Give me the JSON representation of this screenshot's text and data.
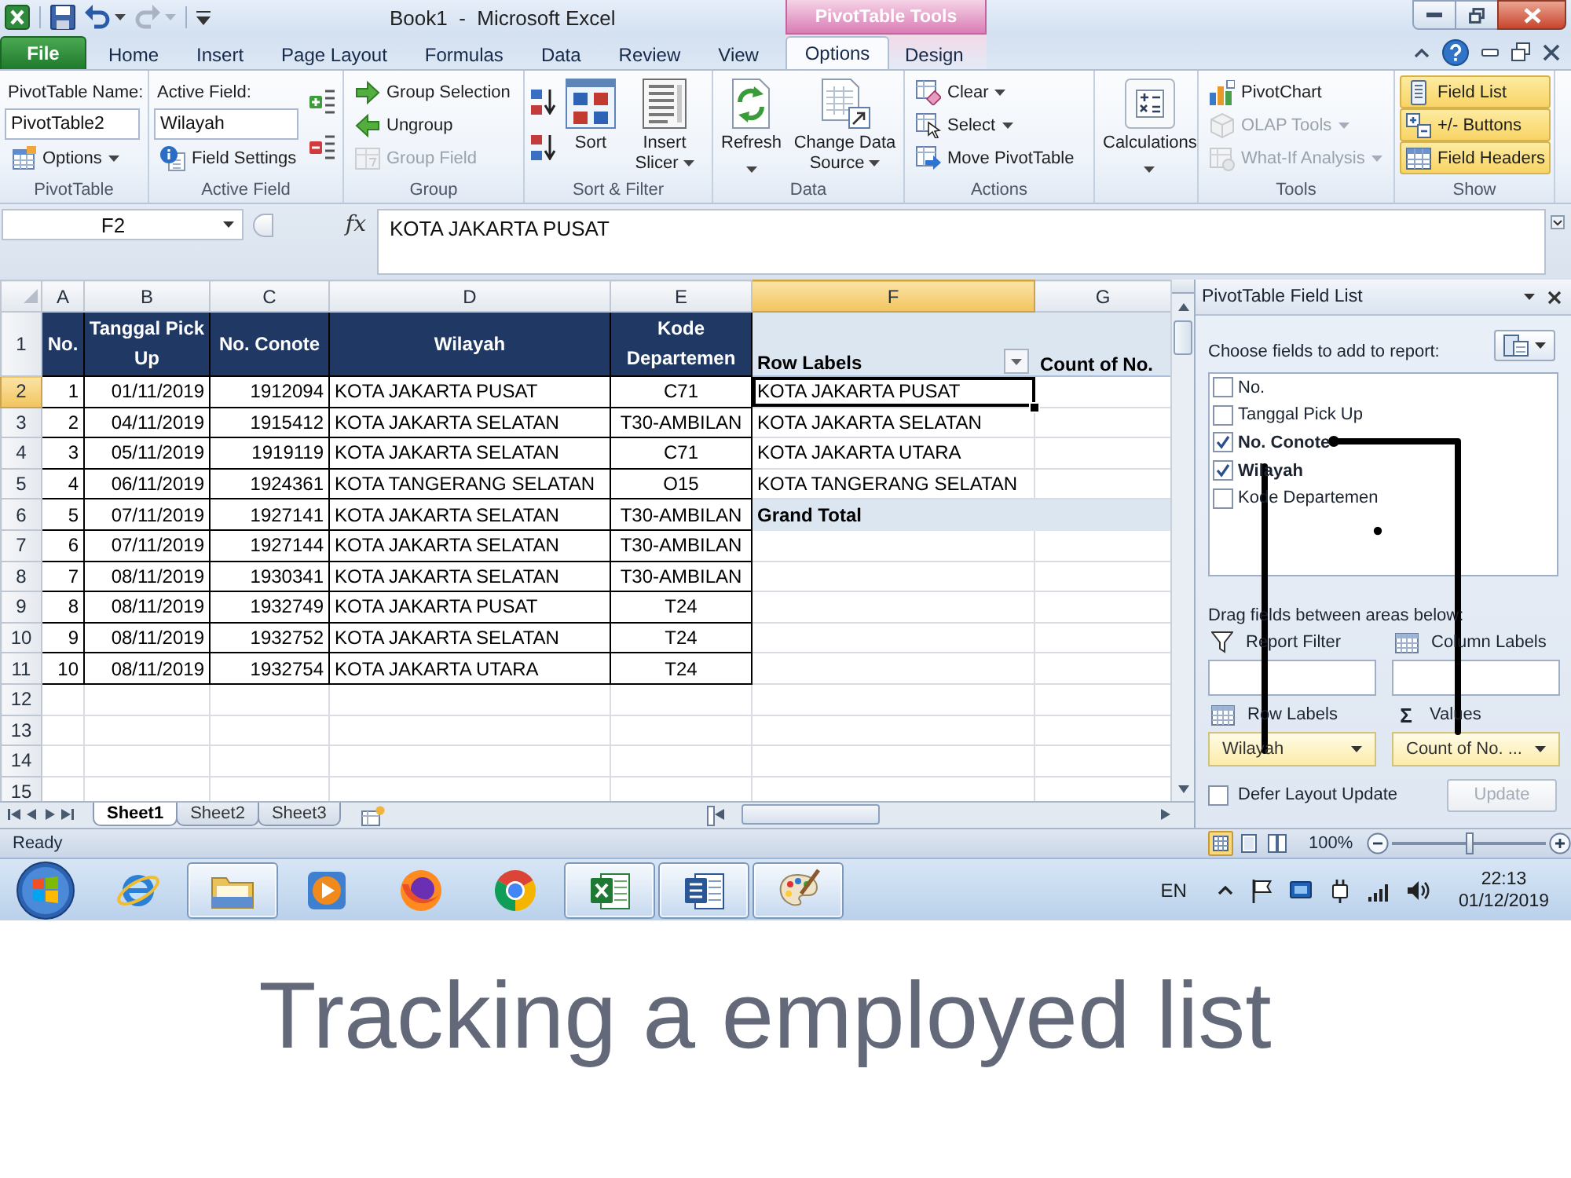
{
  "window": {
    "title": "Book1  -  Microsoft Excel",
    "tool_context": "PivotTable Tools"
  },
  "ribbon_tabs": [
    {
      "label": "File",
      "kind": "file",
      "selected": false
    },
    {
      "label": "Home",
      "kind": "standard",
      "selected": false
    },
    {
      "label": "Insert",
      "kind": "standard",
      "selected": false
    },
    {
      "label": "Page Layout",
      "kind": "standard",
      "selected": false
    },
    {
      "label": "Formulas",
      "kind": "standard",
      "selected": false
    },
    {
      "label": "Data",
      "kind": "standard",
      "selected": false
    },
    {
      "label": "Review",
      "kind": "standard",
      "selected": false
    },
    {
      "label": "View",
      "kind": "standard",
      "selected": false
    },
    {
      "label": "Options",
      "kind": "contextual",
      "selected": true
    },
    {
      "label": "Design",
      "kind": "contextual",
      "selected": false
    }
  ],
  "ribbon_groups": [
    {
      "label": "PivotTable",
      "columns": [
        [
          {
            "kind": "caption",
            "text": "PivotTable Name:"
          },
          {
            "kind": "field",
            "value": "PivotTable2"
          },
          {
            "kind": "small",
            "label": "Options",
            "dropdown": true,
            "disabled": false
          }
        ]
      ]
    },
    {
      "label": "Active Field",
      "columns": [
        [
          {
            "kind": "caption",
            "text": "Active Field:"
          },
          {
            "kind": "field",
            "value": "Wilayah"
          },
          {
            "kind": "small",
            "label": "Field Settings",
            "dropdown": false,
            "disabled": false
          }
        ],
        [
          {
            "kind": "icon",
            "disabled": false
          },
          {
            "kind": "icon",
            "disabled": false
          }
        ]
      ]
    },
    {
      "label": "Group",
      "columns": [
        [
          {
            "kind": "small",
            "label": "Group Selection",
            "dropdown": false,
            "disabled": false
          },
          {
            "kind": "small",
            "label": "Ungroup",
            "dropdown": false,
            "disabled": false
          },
          {
            "kind": "small",
            "label": "Group Field",
            "dropdown": false,
            "disabled": true
          }
        ]
      ]
    },
    {
      "label": "Sort & Filter",
      "columns": [
        [
          {
            "kind": "icon",
            "disabled": false
          },
          {
            "kind": "icon",
            "disabled": false
          }
        ],
        [
          {
            "kind": "large",
            "label": "Sort",
            "dropdown": false,
            "disabled": false
          }
        ],
        [
          {
            "kind": "large",
            "label": "Insert Slicer",
            "dropdown": true,
            "disabled": false
          }
        ]
      ]
    },
    {
      "label": "Data",
      "columns": [
        [
          {
            "kind": "large",
            "label": "Refresh",
            "dropdown": true,
            "disabled": false
          }
        ],
        [
          {
            "kind": "large",
            "label": "Change Data Source",
            "dropdown": true,
            "disabled": false
          }
        ]
      ]
    },
    {
      "label": "Actions",
      "columns": [
        [
          {
            "kind": "small",
            "label": "Clear",
            "dropdown": true,
            "disabled": false
          },
          {
            "kind": "small",
            "label": "Select",
            "dropdown": true,
            "disabled": false
          },
          {
            "kind": "small",
            "label": "Move PivotTable",
            "dropdown": false,
            "disabled": false
          }
        ]
      ]
    },
    {
      "columns": [
        [
          {
            "kind": "large",
            "label": "Calculations",
            "dropdown": true,
            "disabled": false
          }
        ]
      ]
    },
    {
      "label": "Tools",
      "columns": [
        [
          {
            "kind": "small",
            "label": "PivotChart",
            "dropdown": false,
            "disabled": false
          },
          {
            "kind": "small",
            "label": "OLAP Tools",
            "dropdown": true,
            "disabled": true
          },
          {
            "kind": "small",
            "label": "What-If Analysis",
            "dropdown": true,
            "disabled": true
          }
        ]
      ]
    },
    {
      "label": "Show",
      "columns": [
        [
          {
            "kind": "small",
            "label": "Field List",
            "dropdown": false,
            "disabled": false,
            "on": true
          },
          {
            "kind": "small",
            "label": "+/- Buttons",
            "dropdown": false,
            "disabled": false,
            "on": true
          },
          {
            "kind": "small",
            "label": "Field Headers",
            "dropdown": false,
            "disabled": false,
            "on": true
          }
        ]
      ]
    }
  ],
  "formula_bar": {
    "name_box": "F2",
    "function_label": "fx",
    "formula": "KOTA JAKARTA PUSAT"
  },
  "sheet": {
    "column_headers": [
      {
        "label": "A",
        "selected": false
      },
      {
        "label": "B",
        "selected": false
      },
      {
        "label": "C",
        "selected": false
      },
      {
        "label": "D",
        "selected": false
      },
      {
        "label": "E",
        "selected": false
      },
      {
        "label": "F",
        "selected": true
      },
      {
        "label": "G",
        "selected": false
      }
    ],
    "row_headers": [
      {
        "label": "1",
        "selected": false
      },
      {
        "label": "2",
        "selected": true
      },
      {
        "label": "3",
        "selected": false
      },
      {
        "label": "4",
        "selected": false
      },
      {
        "label": "5",
        "selected": false
      },
      {
        "label": "6",
        "selected": false
      },
      {
        "label": "7",
        "selected": false
      },
      {
        "label": "8",
        "selected": false
      },
      {
        "label": "9",
        "selected": false
      },
      {
        "label": "10",
        "selected": false
      },
      {
        "label": "11",
        "selected": false
      },
      {
        "label": "12",
        "selected": false
      },
      {
        "label": "13",
        "selected": false
      },
      {
        "label": "14",
        "selected": false
      },
      {
        "label": "15",
        "selected": false
      }
    ],
    "table": {
      "columns": [
        "No.",
        "Tanggal Pick Up",
        "No. Conote",
        "Wilayah",
        "Kode Departemen"
      ],
      "rows": [
        [
          "1",
          "01/11/2019",
          "1912094",
          "KOTA JAKARTA PUSAT",
          "C71"
        ],
        [
          "2",
          "04/11/2019",
          "1915412",
          "KOTA JAKARTA SELATAN",
          "T30-AMBILAN"
        ],
        [
          "3",
          "05/11/2019",
          "1919119",
          "KOTA JAKARTA SELATAN",
          "C71"
        ],
        [
          "4",
          "06/11/2019",
          "1924361",
          "KOTA TANGERANG SELATAN",
          "O15"
        ],
        [
          "5",
          "07/11/2019",
          "1927141",
          "KOTA JAKARTA SELATAN",
          "T30-AMBILAN"
        ],
        [
          "6",
          "07/11/2019",
          "1927144",
          "KOTA JAKARTA SELATAN",
          "T30-AMBILAN"
        ],
        [
          "7",
          "08/11/2019",
          "1930341",
          "KOTA JAKARTA SELATAN",
          "T30-AMBILAN"
        ],
        [
          "8",
          "08/11/2019",
          "1932749",
          "KOTA JAKARTA PUSAT",
          "T24"
        ],
        [
          "9",
          "08/11/2019",
          "1932752",
          "KOTA JAKARTA SELATAN",
          "T24"
        ],
        [
          "10",
          "08/11/2019",
          "1932754",
          "KOTA JAKARTA UTARA",
          "T24"
        ]
      ]
    },
    "pivot": {
      "columns": [
        "Row Labels",
        "Count of No."
      ],
      "rows": [
        {
          "label": "KOTA JAKARTA PUSAT",
          "selected": true
        },
        {
          "label": "KOTA JAKARTA SELATAN",
          "selected": false
        },
        {
          "label": "KOTA JAKARTA UTARA",
          "selected": false
        },
        {
          "label": "KOTA TANGERANG SELATAN",
          "selected": false
        }
      ],
      "grand_total": "Grand Total"
    }
  },
  "sheet_tabs": [
    {
      "label": "Sheet1",
      "selected": true
    },
    {
      "label": "Sheet2",
      "selected": false
    },
    {
      "label": "Sheet3",
      "selected": false
    }
  ],
  "field_list": {
    "title": "PivotTable Field List",
    "prompt": "Choose fields to add to report:",
    "fields": [
      {
        "label": "No.",
        "checked": false
      },
      {
        "label": "Tanggal Pick Up",
        "checked": false
      },
      {
        "label": "No. Conote",
        "checked": true
      },
      {
        "label": "Wilayah",
        "checked": true
      },
      {
        "label": "Kode Departemen",
        "checked": false
      }
    ],
    "areas_prompt": "Drag fields between areas below:",
    "areas": [
      {
        "kind": "filter",
        "label": "Report Filter"
      },
      {
        "kind": "columns",
        "label": "Column Labels"
      },
      {
        "kind": "rows",
        "label": "Row Labels",
        "value": "Wilayah"
      },
      {
        "kind": "values",
        "symbol": "Σ",
        "label": "Values",
        "value": "Count of No. ..."
      }
    ],
    "defer": {
      "label": "Defer Layout Update",
      "checked": false
    },
    "update": {
      "label": "Update",
      "disabled": true
    }
  },
  "status_bar": {
    "text": "Ready",
    "views": [
      {
        "selected": true
      },
      {
        "selected": false
      },
      {
        "selected": false
      }
    ],
    "zoom": "100%",
    "zoom_slider": {
      "level": 0.5
    }
  },
  "taskbar": {
    "apps": [
      {
        "kind": "ie",
        "open": false
      },
      {
        "kind": "explorer",
        "open": true
      },
      {
        "kind": "media",
        "open": false
      },
      {
        "kind": "firefox",
        "open": false
      },
      {
        "kind": "chrome",
        "open": false
      },
      {
        "kind": "excel",
        "open": true
      },
      {
        "kind": "word",
        "open": true
      },
      {
        "kind": "paint",
        "open": true
      }
    ],
    "language": "EN",
    "time": "22:13",
    "date": "01/12/2019"
  },
  "caption": "Tracking a employed list"
}
